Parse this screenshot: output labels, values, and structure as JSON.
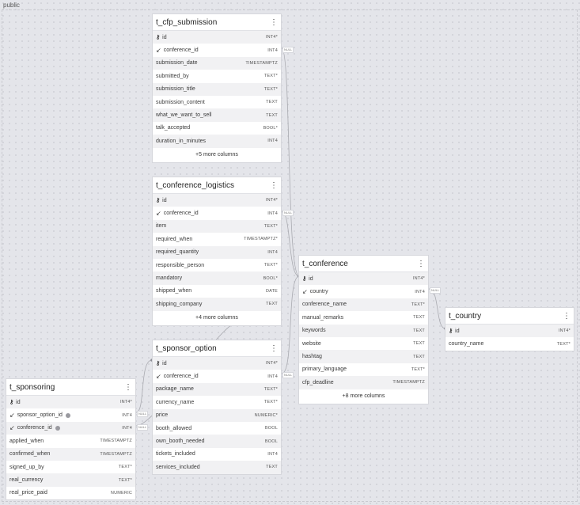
{
  "schema": {
    "label": "public"
  },
  "colors": {
    "edge": "#a9aab0",
    "canvas": "#e4e5ea"
  },
  "icons": {
    "pk": "key-icon",
    "fk": "foreign-key-arrow-icon",
    "menu": "kebab-menu-icon"
  },
  "tables": {
    "t_cfp_submission": {
      "name": "t_cfp_submission",
      "columns": [
        {
          "name": "id",
          "type": "INT4*",
          "pk": true
        },
        {
          "name": "conference_id",
          "type": "INT4",
          "fk": true
        },
        {
          "name": "submission_date",
          "type": "TIMESTAMPTZ"
        },
        {
          "name": "submitted_by",
          "type": "TEXT*"
        },
        {
          "name": "submission_title",
          "type": "TEXT*"
        },
        {
          "name": "submission_content",
          "type": "TEXT"
        },
        {
          "name": "what_we_want_to_sell",
          "type": "TEXT"
        },
        {
          "name": "talk_accepted",
          "type": "BOOL*"
        },
        {
          "name": "duration_in_minutes",
          "type": "INT4"
        }
      ],
      "more": "+5 more columns"
    },
    "t_conference_logistics": {
      "name": "t_conference_logistics",
      "columns": [
        {
          "name": "id",
          "type": "INT4*",
          "pk": true
        },
        {
          "name": "conference_id",
          "type": "INT4",
          "fk": true
        },
        {
          "name": "item",
          "type": "TEXT*"
        },
        {
          "name": "required_when",
          "type": "TIMESTAMPTZ*"
        },
        {
          "name": "required_quantity",
          "type": "INT4"
        },
        {
          "name": "responsible_person",
          "type": "TEXT*"
        },
        {
          "name": "mandatory",
          "type": "BOOL*"
        },
        {
          "name": "shipped_when",
          "type": "DATE"
        },
        {
          "name": "shipping_company",
          "type": "TEXT"
        }
      ],
      "more": "+4 more columns"
    },
    "t_sponsor_option": {
      "name": "t_sponsor_option",
      "columns": [
        {
          "name": "id",
          "type": "INT4*",
          "pk": true
        },
        {
          "name": "conference_id",
          "type": "INT4",
          "fk": true
        },
        {
          "name": "package_name",
          "type": "TEXT*"
        },
        {
          "name": "currency_name",
          "type": "TEXT*"
        },
        {
          "name": "price",
          "type": "NUMERIC*"
        },
        {
          "name": "booth_allowed",
          "type": "BOOL"
        },
        {
          "name": "own_booth_needed",
          "type": "BOOL"
        },
        {
          "name": "tickets_included",
          "type": "INT4"
        },
        {
          "name": "services_included",
          "type": "TEXT"
        }
      ],
      "more": ""
    },
    "t_conference": {
      "name": "t_conference",
      "columns": [
        {
          "name": "id",
          "type": "INT4*",
          "pk": true
        },
        {
          "name": "country",
          "type": "INT4",
          "fk": true
        },
        {
          "name": "conference_name",
          "type": "TEXT*"
        },
        {
          "name": "manual_remarks",
          "type": "TEXT"
        },
        {
          "name": "keywords",
          "type": "TEXT"
        },
        {
          "name": "website",
          "type": "TEXT"
        },
        {
          "name": "hashtag",
          "type": "TEXT"
        },
        {
          "name": "primary_language",
          "type": "TEXT*"
        },
        {
          "name": "cfp_deadline",
          "type": "TIMESTAMPTZ"
        }
      ],
      "more": "+8 more columns"
    },
    "t_country": {
      "name": "t_country",
      "columns": [
        {
          "name": "id",
          "type": "INT4*",
          "pk": true
        },
        {
          "name": "country_name",
          "type": "TEXT*"
        }
      ],
      "more": ""
    },
    "t_sponsoring": {
      "name": "t_sponsoring",
      "columns": [
        {
          "name": "id",
          "type": "INT4*",
          "pk": true
        },
        {
          "name": "sponsor_option_id",
          "type": "INT4",
          "fk": true,
          "info": true
        },
        {
          "name": "conference_id",
          "type": "INT4",
          "fk": true,
          "info": true
        },
        {
          "name": "applied_when",
          "type": "TIMESTAMPTZ"
        },
        {
          "name": "confirmed_when",
          "type": "TIMESTAMPTZ"
        },
        {
          "name": "signed_up_by",
          "type": "TEXT*"
        },
        {
          "name": "real_currency",
          "type": "TEXT*"
        },
        {
          "name": "real_price_paid",
          "type": "NUMERIC"
        }
      ],
      "more": ""
    }
  },
  "null_badge": "NULL"
}
